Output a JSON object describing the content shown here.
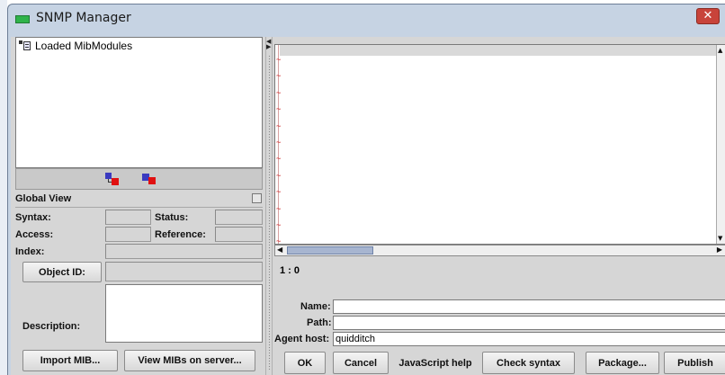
{
  "window": {
    "title": "SNMP Manager",
    "close_glyph": "✕"
  },
  "tree": {
    "root_label": "Loaded MibModules",
    "root_icon": "tree-node-icon"
  },
  "toolbar": {
    "icons": [
      "expand-tree-icon",
      "collapse-tree-icon"
    ]
  },
  "view": {
    "label": "Global View"
  },
  "form": {
    "syntax_label": "Syntax:",
    "status_label": "Status:",
    "access_label": "Access:",
    "reference_label": "Reference:",
    "index_label": "Index:",
    "object_id_button": "Object ID:",
    "description_label": "Description:"
  },
  "left_buttons": {
    "import": "Import MIB...",
    "view_mibs": "View MIBs on server..."
  },
  "editor": {
    "cursor_position": "1 : 0",
    "tilde_glyph": "~"
  },
  "fields": {
    "name_label": "Name:",
    "name_value": "",
    "path_label": "Path:",
    "path_value": "",
    "agent_host_label": "Agent host:",
    "agent_host_value": "quidditch"
  },
  "bottom_buttons": {
    "ok": "OK",
    "cancel": "Cancel",
    "js_help": "JavaScript help",
    "check_syntax": "Check syntax",
    "package": "Package...",
    "publish": "Publish"
  },
  "colors": {
    "titlebar": "#c6d3e3",
    "close": "#c8433a",
    "app_icon": "#2fb34a",
    "tilde": "#cc2222"
  }
}
